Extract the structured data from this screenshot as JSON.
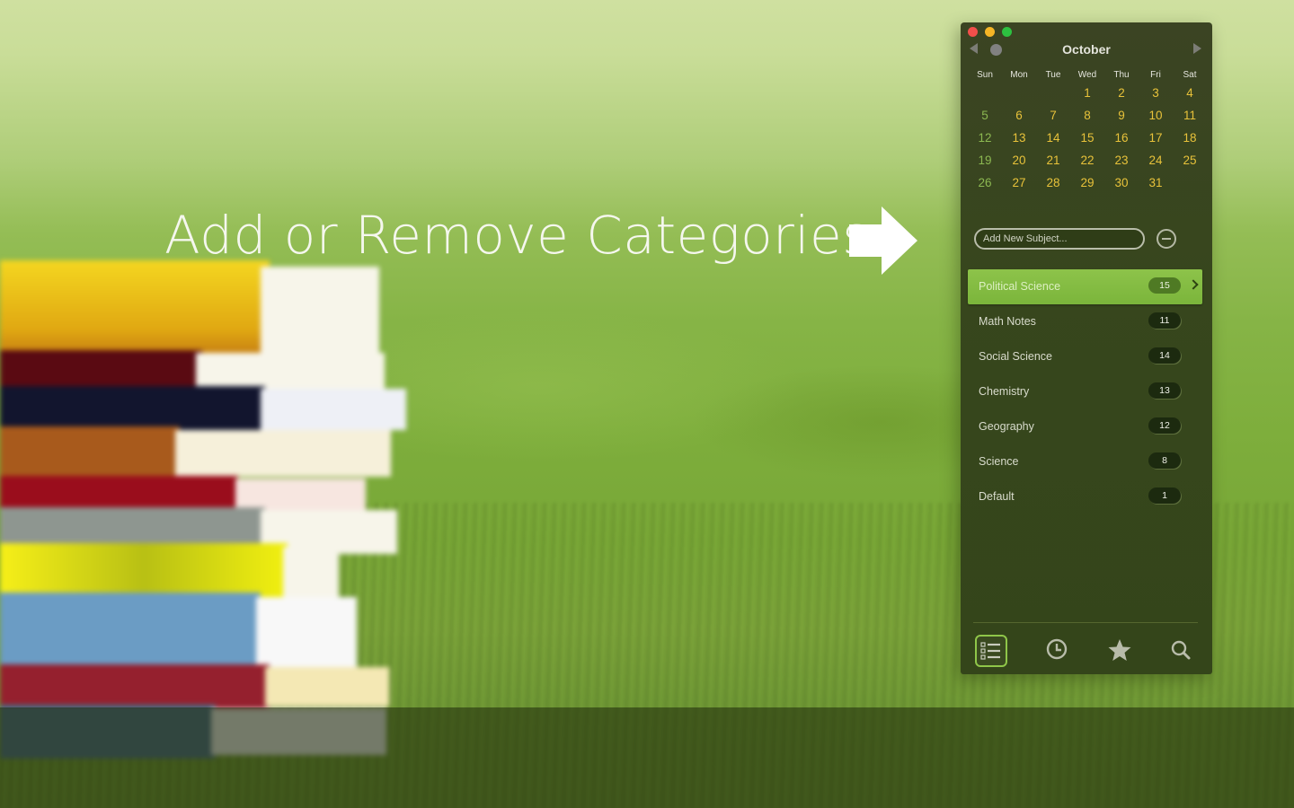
{
  "promo": {
    "headline": "Add or Remove Categories",
    "arrow_icon": "right-arrow-icon"
  },
  "window": {
    "controls": [
      "close",
      "minimize",
      "maximize"
    ],
    "calendar": {
      "month": "October",
      "prev_icon": "triangle-left-icon",
      "today_icon": "circle-dot-icon",
      "next_icon": "triangle-right-icon",
      "weekdays": [
        "Sun",
        "Mon",
        "Tue",
        "Wed",
        "Thu",
        "Fri",
        "Sat"
      ],
      "weeks": [
        [
          "",
          "",
          "",
          "1",
          "2",
          "3",
          "4"
        ],
        [
          "5",
          "6",
          "7",
          "8",
          "9",
          "10",
          "11"
        ],
        [
          "12",
          "13",
          "14",
          "15",
          "16",
          "17",
          "18"
        ],
        [
          "19",
          "20",
          "21",
          "22",
          "23",
          "24",
          "25"
        ],
        [
          "26",
          "27",
          "28",
          "29",
          "30",
          "31",
          ""
        ]
      ],
      "weekday_color": "#e8c23a",
      "sunday_color": "#8cb851"
    },
    "add_subject": {
      "placeholder": "Add New Subject...",
      "value": "",
      "remove_icon": "minus-circle-icon"
    },
    "categories": [
      {
        "label": "Political Science",
        "count": "15",
        "selected": true
      },
      {
        "label": "Math Notes",
        "count": "11",
        "selected": false
      },
      {
        "label": "Social Science",
        "count": "14",
        "selected": false
      },
      {
        "label": "Chemistry",
        "count": "13",
        "selected": false
      },
      {
        "label": "Geography",
        "count": "12",
        "selected": false
      },
      {
        "label": "Science",
        "count": "8",
        "selected": false
      },
      {
        "label": "Default",
        "count": "1",
        "selected": false
      }
    ],
    "toolbar": [
      {
        "name": "list-icon",
        "active": true
      },
      {
        "name": "clock-icon",
        "active": false
      },
      {
        "name": "star-icon",
        "active": false
      },
      {
        "name": "search-icon",
        "active": false
      }
    ],
    "accent_color": "#8dc34a"
  }
}
